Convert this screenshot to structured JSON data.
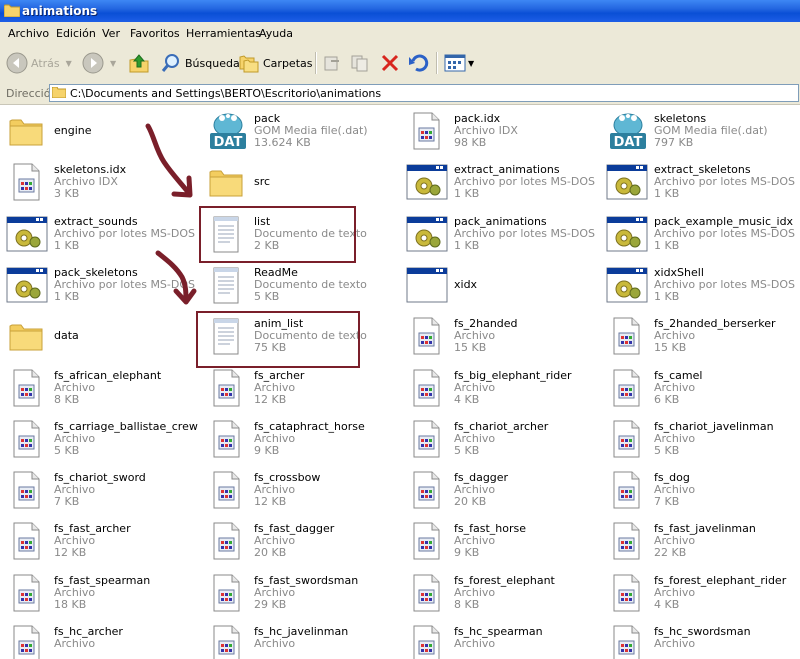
{
  "window": {
    "title": "animations"
  },
  "menu": [
    "Archivo",
    "Edición",
    "Ver",
    "Favoritos",
    "Herramientas",
    "Ayuda"
  ],
  "toolbar": {
    "back": "Atrás",
    "search": "Búsqueda",
    "folders": "Carpetas"
  },
  "address": {
    "label": "Dirección",
    "path": "C:\\Documents and Settings\\BERTO\\Escritorio\\animations"
  },
  "files": [
    {
      "name": "engine",
      "type": "",
      "size": "",
      "icon": "folder-icon"
    },
    {
      "name": "pack",
      "type": "GOM Media file(.dat)",
      "size": "13.624 KB",
      "icon": "dat-file-icon"
    },
    {
      "name": "pack.idx",
      "type": "Archivo IDX",
      "size": "98 KB",
      "icon": "idx-file-icon"
    },
    {
      "name": "skeletons",
      "type": "GOM Media file(.dat)",
      "size": "797 KB",
      "icon": "dat-file-icon"
    },
    {
      "name": "skeletons.idx",
      "type": "Archivo IDX",
      "size": "3 KB",
      "icon": "idx-file-icon"
    },
    {
      "name": "src",
      "type": "",
      "size": "",
      "icon": "folder-icon"
    },
    {
      "name": "extract_animations",
      "type": "Archivo por lotes MS-DOS",
      "size": "1 KB",
      "icon": "batch-file-icon"
    },
    {
      "name": "extract_skeletons",
      "type": "Archivo por lotes MS-DOS",
      "size": "1 KB",
      "icon": "batch-file-icon"
    },
    {
      "name": "extract_sounds",
      "type": "Archivo por lotes MS-DOS",
      "size": "1 KB",
      "icon": "batch-file-icon"
    },
    {
      "name": "list",
      "type": "Documento de texto",
      "size": "2 KB",
      "icon": "text-file-icon"
    },
    {
      "name": "pack_animations",
      "type": "Archivo por lotes MS-DOS",
      "size": "1 KB",
      "icon": "batch-file-icon"
    },
    {
      "name": "pack_example_music_idx",
      "type": "Archivo por lotes MS-DOS",
      "size": "1 KB",
      "icon": "batch-file-icon"
    },
    {
      "name": "pack_skeletons",
      "type": "Archivo por lotes MS-DOS",
      "size": "1 KB",
      "icon": "batch-file-icon"
    },
    {
      "name": "ReadMe",
      "type": "Documento de texto",
      "size": "5 KB",
      "icon": "text-file-icon"
    },
    {
      "name": "xidx",
      "type": "",
      "size": "",
      "icon": "exe-window-icon"
    },
    {
      "name": "xidxShell",
      "type": "Archivo por lotes MS-DOS",
      "size": "1 KB",
      "icon": "batch-file-icon"
    },
    {
      "name": "data",
      "type": "",
      "size": "",
      "icon": "folder-icon"
    },
    {
      "name": "anim_list",
      "type": "Documento de texto",
      "size": "75 KB",
      "icon": "text-file-icon"
    },
    {
      "name": "fs_2handed",
      "type": "Archivo",
      "size": "15 KB",
      "icon": "generic-file-icon"
    },
    {
      "name": "fs_2handed_berserker",
      "type": "Archivo",
      "size": "15 KB",
      "icon": "generic-file-icon"
    },
    {
      "name": "fs_african_elephant",
      "type": "Archivo",
      "size": "8 KB",
      "icon": "generic-file-icon"
    },
    {
      "name": "fs_archer",
      "type": "Archivo",
      "size": "12 KB",
      "icon": "generic-file-icon"
    },
    {
      "name": "fs_big_elephant_rider",
      "type": "Archivo",
      "size": "4 KB",
      "icon": "generic-file-icon"
    },
    {
      "name": "fs_camel",
      "type": "Archivo",
      "size": "6 KB",
      "icon": "generic-file-icon"
    },
    {
      "name": "fs_carriage_ballistae_crew",
      "type": "Archivo",
      "size": "5 KB",
      "icon": "generic-file-icon"
    },
    {
      "name": "fs_cataphract_horse",
      "type": "Archivo",
      "size": "9 KB",
      "icon": "generic-file-icon"
    },
    {
      "name": "fs_chariot_archer",
      "type": "Archivo",
      "size": "5 KB",
      "icon": "generic-file-icon"
    },
    {
      "name": "fs_chariot_javelinman",
      "type": "Archivo",
      "size": "5 KB",
      "icon": "generic-file-icon"
    },
    {
      "name": "fs_chariot_sword",
      "type": "Archivo",
      "size": "7 KB",
      "icon": "generic-file-icon"
    },
    {
      "name": "fs_crossbow",
      "type": "Archivo",
      "size": "12 KB",
      "icon": "generic-file-icon"
    },
    {
      "name": "fs_dagger",
      "type": "Archivo",
      "size": "20 KB",
      "icon": "generic-file-icon"
    },
    {
      "name": "fs_dog",
      "type": "Archivo",
      "size": "7 KB",
      "icon": "generic-file-icon"
    },
    {
      "name": "fs_fast_archer",
      "type": "Archivo",
      "size": "12 KB",
      "icon": "generic-file-icon"
    },
    {
      "name": "fs_fast_dagger",
      "type": "Archivo",
      "size": "20 KB",
      "icon": "generic-file-icon"
    },
    {
      "name": "fs_fast_horse",
      "type": "Archivo",
      "size": "9 KB",
      "icon": "generic-file-icon"
    },
    {
      "name": "fs_fast_javelinman",
      "type": "Archivo",
      "size": "22 KB",
      "icon": "generic-file-icon"
    },
    {
      "name": "fs_fast_spearman",
      "type": "Archivo",
      "size": "18 KB",
      "icon": "generic-file-icon"
    },
    {
      "name": "fs_fast_swordsman",
      "type": "Archivo",
      "size": "29 KB",
      "icon": "generic-file-icon"
    },
    {
      "name": "fs_forest_elephant",
      "type": "Archivo",
      "size": "8 KB",
      "icon": "generic-file-icon"
    },
    {
      "name": "fs_forest_elephant_rider",
      "type": "Archivo",
      "size": "4 KB",
      "icon": "generic-file-icon"
    },
    {
      "name": "fs_hc_archer",
      "type": "Archivo",
      "size": "",
      "icon": "generic-file-icon"
    },
    {
      "name": "fs_hc_javelinman",
      "type": "Archivo",
      "size": "",
      "icon": "generic-file-icon"
    },
    {
      "name": "fs_hc_spearman",
      "type": "Archivo",
      "size": "",
      "icon": "generic-file-icon"
    },
    {
      "name": "fs_hc_swordsman",
      "type": "Archivo",
      "size": "",
      "icon": "generic-file-icon"
    }
  ],
  "colors": {
    "titlebar": "#0a4fd6",
    "highlight_box": "#7a1f2a",
    "meta_text": "#8a8a8a"
  }
}
